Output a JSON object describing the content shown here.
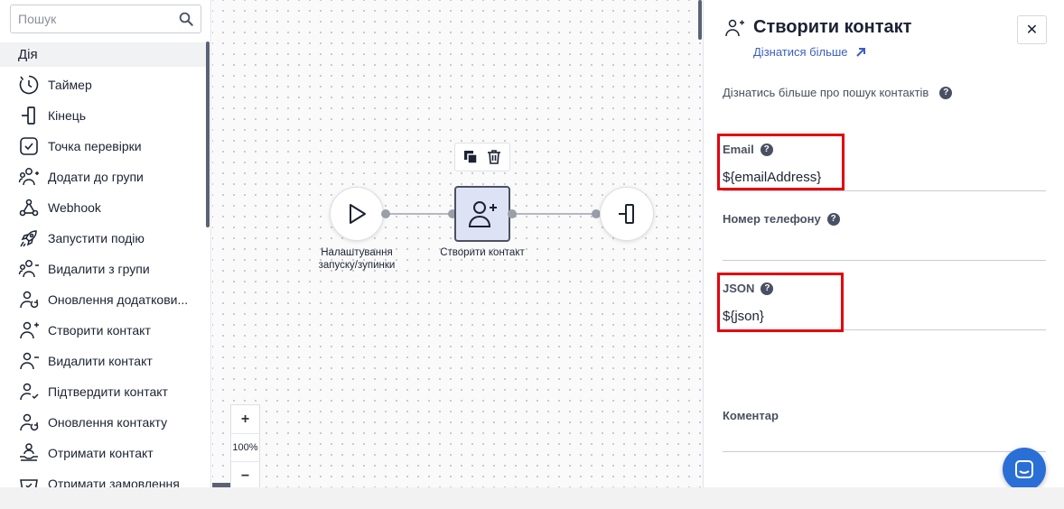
{
  "sidebar": {
    "search_placeholder": "Пошук",
    "category": "Дія",
    "items": [
      {
        "label": "Таймер",
        "icon": "timer-icon"
      },
      {
        "label": "Кінець",
        "icon": "end-icon"
      },
      {
        "label": "Точка перевірки",
        "icon": "checkpoint-icon"
      },
      {
        "label": "Додати до групи",
        "icon": "add-to-group-icon"
      },
      {
        "label": "Webhook",
        "icon": "webhook-icon"
      },
      {
        "label": "Запустити подію",
        "icon": "rocket-icon"
      },
      {
        "label": "Видалити з групи",
        "icon": "remove-from-group-icon"
      },
      {
        "label": "Оновлення додаткови...",
        "icon": "update-additional-icon"
      },
      {
        "label": "Створити контакт",
        "icon": "create-contact-icon"
      },
      {
        "label": "Видалити контакт",
        "icon": "delete-contact-icon"
      },
      {
        "label": "Підтвердити контакт",
        "icon": "confirm-contact-icon"
      },
      {
        "label": "Оновлення контакту",
        "icon": "update-contact-icon"
      },
      {
        "label": "Отримати контакт",
        "icon": "get-contact-icon"
      },
      {
        "label": "Отримати замовлення",
        "icon": "get-order-icon"
      }
    ]
  },
  "canvas": {
    "nodes": {
      "start_label": "Налаштування запуску/зупинки",
      "create_label": "Створити контакт"
    },
    "zoom": {
      "plus": "+",
      "value": "100%",
      "minus": "−"
    }
  },
  "panel": {
    "title": "Створити контакт",
    "learn_more": "Дізнатися більше",
    "info": "Дізнатись більше про пошук контактів",
    "help_glyph": "?",
    "close_glyph": "✕",
    "fields": {
      "email": {
        "label": "Email",
        "value": "${emailAddress}"
      },
      "phone": {
        "label": "Номер телефону",
        "value": ""
      },
      "json": {
        "label": "JSON",
        "value": "${json}"
      },
      "comment": {
        "label": "Коментар",
        "value": ""
      }
    }
  },
  "colors": {
    "accent": "#3b5fc0",
    "highlight": "#e3000f",
    "node_selected": "#dde3f4",
    "chat_button": "#2a6fd6"
  }
}
